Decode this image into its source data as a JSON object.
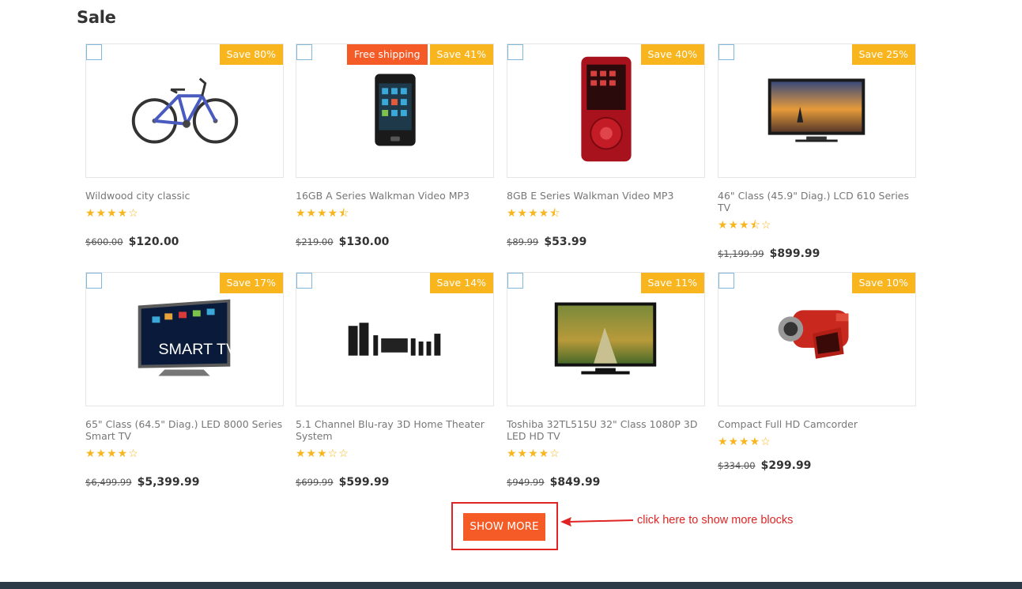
{
  "section": {
    "title": "Sale"
  },
  "products": [
    {
      "name": "Wildwood city classic",
      "stars": "★★★★☆",
      "old_price": "$600.00",
      "price": "$120.00",
      "save": "Save 80%",
      "shipping": ""
    },
    {
      "name": "16GB A Series Walkman Video MP3",
      "stars": "★★★★⯪",
      "old_price": "$219.00",
      "price": "$130.00",
      "save": "Save 41%",
      "shipping": "Free shipping"
    },
    {
      "name": "8GB E Series Walkman Video MP3",
      "stars": "★★★★⯪",
      "old_price": "$89.99",
      "price": "$53.99",
      "save": "Save 40%",
      "shipping": ""
    },
    {
      "name": "46\" Class (45.9\" Diag.) LCD 610 Series TV",
      "stars": "★★★⯪☆",
      "old_price": "$1,199.99",
      "price": "$899.99",
      "save": "Save 25%",
      "shipping": ""
    },
    {
      "name": "65\" Class (64.5\" Diag.) LED 8000 Series Smart TV",
      "stars": "★★★★☆",
      "old_price": "$6,499.99",
      "price": "$5,399.99",
      "save": "Save 17%",
      "shipping": ""
    },
    {
      "name": "5.1 Channel Blu-ray 3D Home Theater System",
      "stars": "★★★☆☆",
      "old_price": "$699.99",
      "price": "$599.99",
      "save": "Save 14%",
      "shipping": ""
    },
    {
      "name": "Toshiba 32TL515U 32\" Class 1080P 3D LED HD TV",
      "stars": "★★★★☆",
      "old_price": "$949.99",
      "price": "$849.99",
      "save": "Save 11%",
      "shipping": ""
    },
    {
      "name": "Compact Full HD Camcorder",
      "stars": "★★★★☆",
      "old_price": "$334.00",
      "price": "$299.99",
      "save": "Save 10%",
      "shipping": ""
    }
  ],
  "show_more": {
    "label": "SHOW MORE"
  },
  "annotation": {
    "text": "click here to show more blocks"
  },
  "product_images": [
    "bicycle-image",
    "walkman-mp3-black-image",
    "walkman-mp3-red-image",
    "lcd-tv-image",
    "smart-tv-image",
    "home-theater-image",
    "led-tv-image",
    "camcorder-image"
  ],
  "colors": {
    "save_badge": "#f8b51d",
    "shipping_badge": "#f45b26",
    "button": "#f45b26",
    "annotation": "#e02424",
    "star": "#f8b51d",
    "footer": "#2c3a47"
  }
}
